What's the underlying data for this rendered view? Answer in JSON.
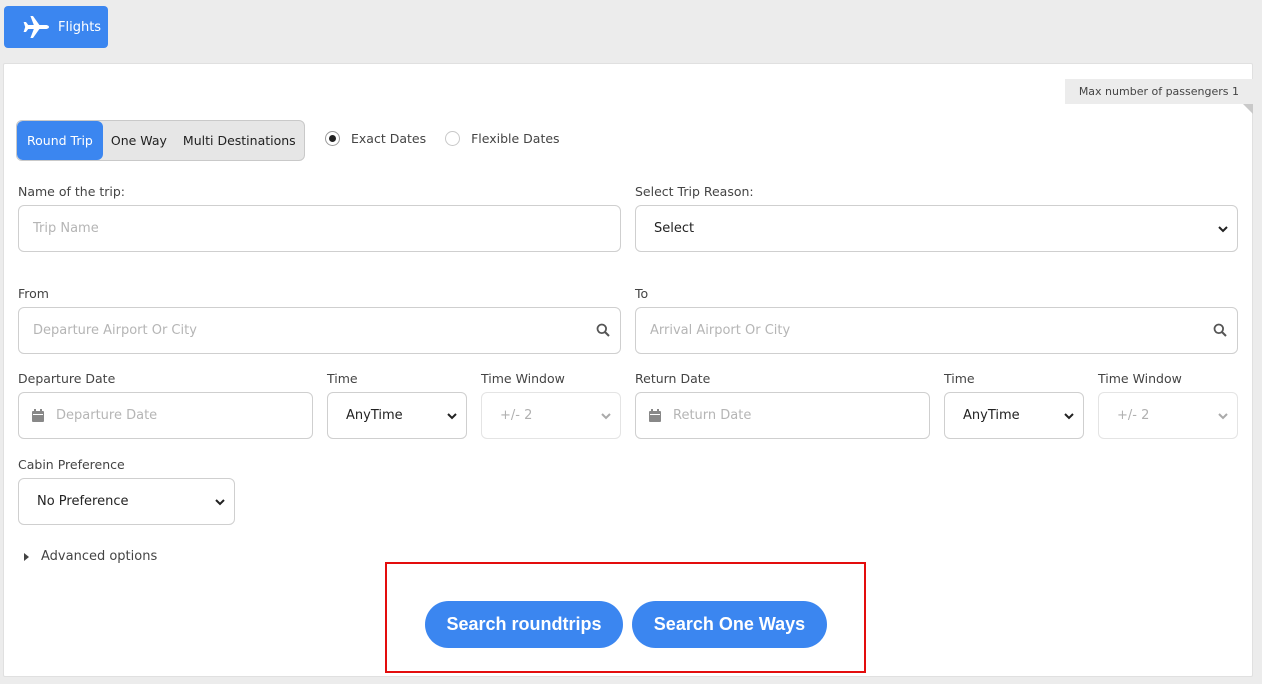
{
  "nav": {
    "flights_label": "Flights",
    "flights_icon": "airplane-icon"
  },
  "panel": {
    "max_passengers": "Max number of passengers 1",
    "trip_types": [
      "Round Trip",
      "One Way",
      "Multi Destinations"
    ],
    "active_trip_type": "Round Trip",
    "date_modes": {
      "exact": "Exact Dates",
      "flexible": "Flexible Dates",
      "selected": "Exact Dates"
    }
  },
  "form": {
    "trip_name": {
      "label": "Name of the trip:",
      "placeholder": "Trip Name",
      "value": ""
    },
    "trip_reason": {
      "label": "Select Trip Reason:",
      "value": "Select"
    },
    "from": {
      "label": "From",
      "placeholder": "Departure Airport Or City"
    },
    "to": {
      "label": "To",
      "placeholder": "Arrival Airport Or City"
    },
    "departure_date": {
      "label": "Departure Date",
      "placeholder": "Departure Date"
    },
    "departure_time": {
      "label": "Time",
      "value": "AnyTime"
    },
    "departure_window": {
      "label": "Time Window",
      "value": "+/- 2"
    },
    "return_date": {
      "label": "Return Date",
      "placeholder": "Return Date"
    },
    "return_time": {
      "label": "Time",
      "value": "AnyTime"
    },
    "return_window": {
      "label": "Time Window",
      "value": "+/- 2"
    },
    "cabin": {
      "label": "Cabin Preference",
      "value": "No Preference"
    },
    "advanced_label": "Advanced options"
  },
  "actions": {
    "search_roundtrips": "Search roundtrips",
    "search_oneways": "Search One Ways"
  },
  "colors": {
    "accent": "#3b86f0",
    "highlight": "#e30d0d"
  }
}
